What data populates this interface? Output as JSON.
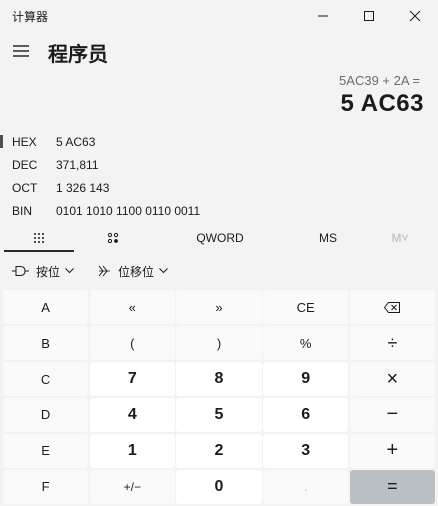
{
  "window": {
    "title": "计算器"
  },
  "header": {
    "mode_title": "程序员"
  },
  "display": {
    "expression": "5AC39 + 2A =",
    "result": "5 AC63"
  },
  "radix": [
    {
      "name": "HEX",
      "value": "5 AC63",
      "selected": true
    },
    {
      "name": "DEC",
      "value": "371,811",
      "selected": false
    },
    {
      "name": "OCT",
      "value": "1 326 143",
      "selected": false
    },
    {
      "name": "BIN",
      "value": "0101 1010 1100 0110 0011",
      "selected": false
    }
  ],
  "modebar": {
    "word_size": "QWORD",
    "ms": "MS",
    "m_dropdown": "M˅"
  },
  "opbar": {
    "bitwise": "按位",
    "bitshift": "位移位"
  },
  "keys": {
    "r1": [
      "A",
      "«",
      "»",
      "CE",
      "backspace"
    ],
    "r2": [
      "B",
      "(",
      ")",
      "%",
      "÷"
    ],
    "r3": [
      "C",
      "7",
      "8",
      "9",
      "×"
    ],
    "r4": [
      "D",
      "4",
      "5",
      "6",
      "−"
    ],
    "r5": [
      "E",
      "1",
      "2",
      "3",
      "+"
    ],
    "r6": [
      "F",
      "+/−",
      "0",
      ".",
      "="
    ]
  },
  "colors": {
    "background": "#f3f3f3",
    "key": "#fafafa",
    "digit_key": "#ffffff",
    "equals": "#b9bfc3"
  }
}
